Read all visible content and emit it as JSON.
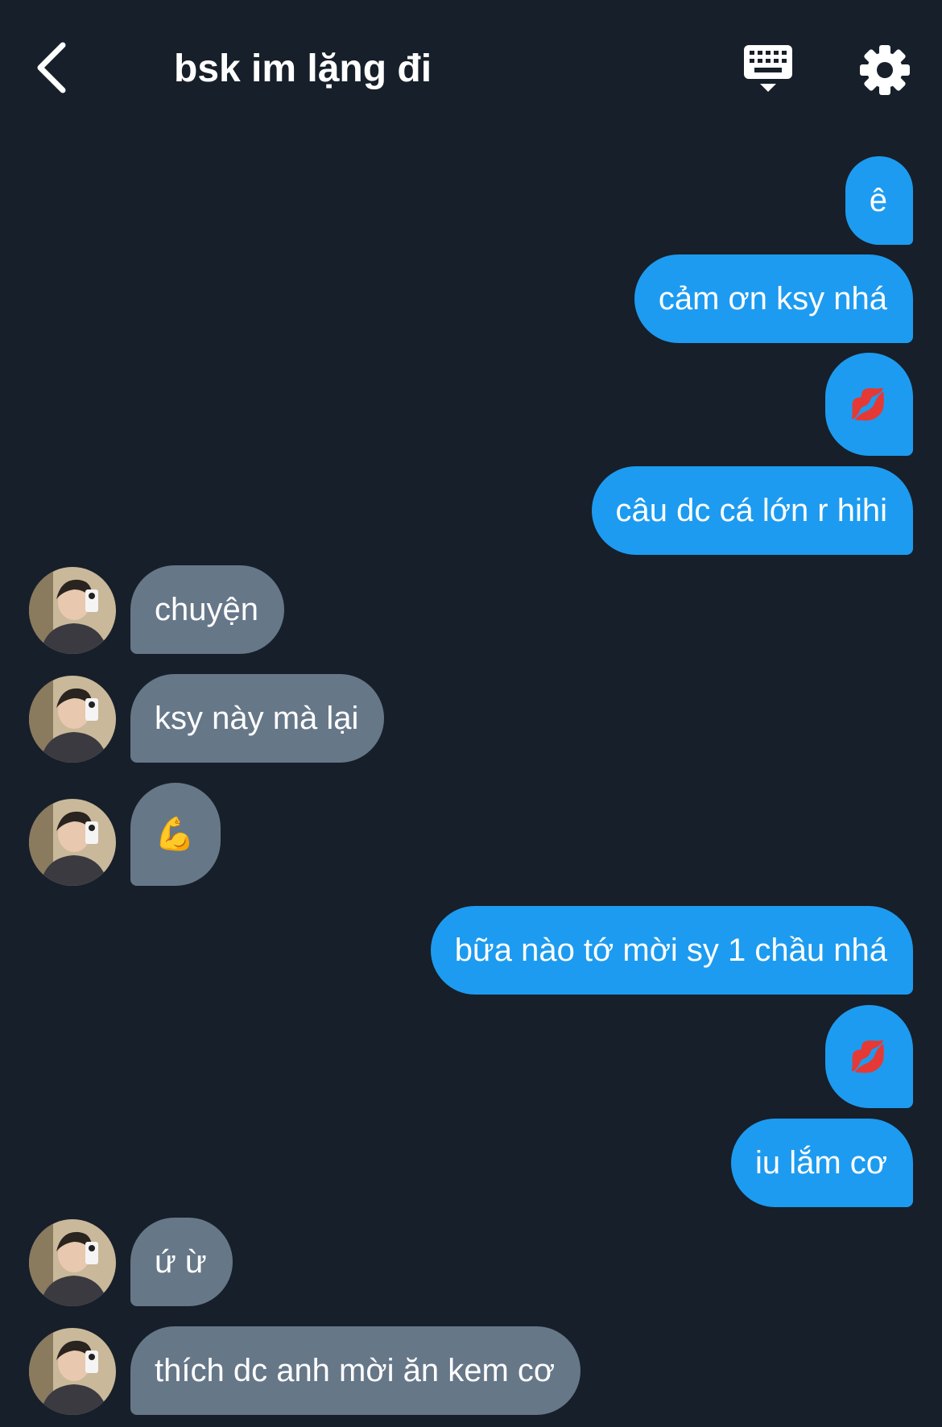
{
  "header": {
    "title": "bsk im lặng đi",
    "back_icon": "chevron-left-icon",
    "keyboard_icon": "keyboard-icon",
    "settings_icon": "gear-icon"
  },
  "colors": {
    "background": "#171f2a",
    "outgoing_bubble": "#1d9bf0",
    "incoming_bubble": "#667788",
    "text": "#ffffff"
  },
  "messages": [
    {
      "side": "out",
      "text": "ê"
    },
    {
      "side": "out",
      "text": "cảm ơn ksy nhá"
    },
    {
      "side": "out",
      "text": "💋",
      "emoji": "kiss-mark-icon"
    },
    {
      "side": "out",
      "text": "câu dc cá lớn r hihi"
    },
    {
      "side": "in",
      "text": "chuyện"
    },
    {
      "side": "in",
      "text": "ksy này mà lại"
    },
    {
      "side": "in",
      "text": "💪",
      "emoji": "flexed-biceps-icon"
    },
    {
      "side": "out",
      "text": "bữa nào tớ mời sy 1 chầu nhá"
    },
    {
      "side": "out",
      "text": "💋",
      "emoji": "kiss-mark-icon"
    },
    {
      "side": "out",
      "text": "iu lắm cơ"
    },
    {
      "side": "in",
      "text": "ứ ừ"
    },
    {
      "side": "in",
      "text": "thích dc anh mời ăn kem cơ"
    }
  ]
}
